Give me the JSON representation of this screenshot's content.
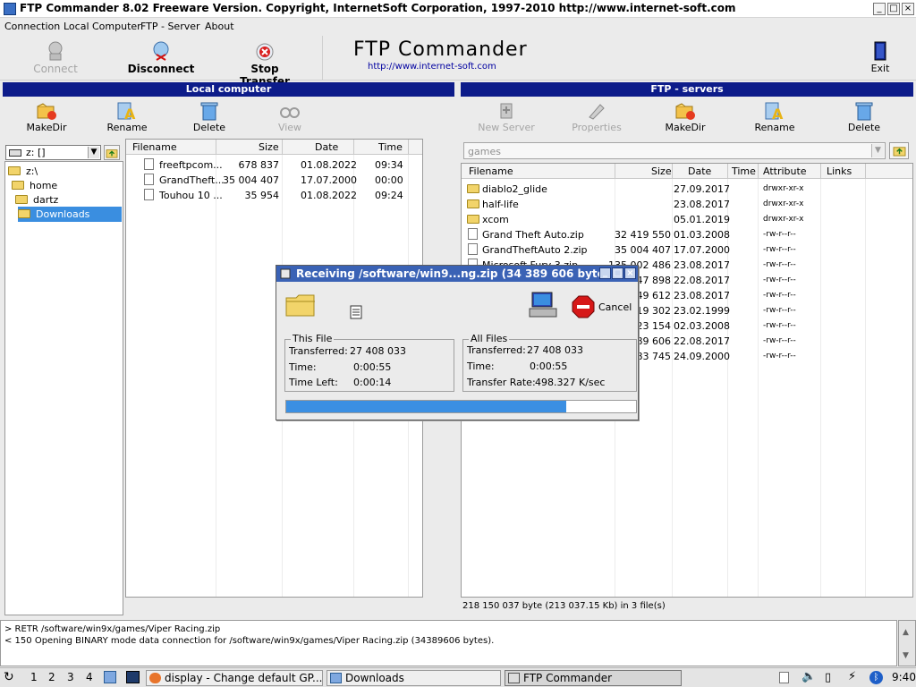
{
  "window": {
    "title": "FTP Commander 8.02  Freeware Version.  Copyright,  InternetSoft Corporation, 1997-2010   http://www.internet-soft.com"
  },
  "menu": [
    "Connection",
    "Local Computer",
    "FTP - Server",
    "About"
  ],
  "toolbar": {
    "connect": "Connect",
    "disconnect": "Disconnect",
    "stop_transfer": "Stop Transfer",
    "brand": "FTP Commander",
    "brand_url": "http://www.internet-soft.com",
    "exit": "Exit"
  },
  "local": {
    "header": "Local computer",
    "buttons": {
      "makedir": "MakeDir",
      "rename": "Rename",
      "delete": "Delete",
      "view": "View"
    },
    "drive": "z: []",
    "tree": [
      "z:\\",
      "home",
      "dartz",
      "Downloads"
    ],
    "columns": [
      "Filename",
      "Size",
      "Date",
      "Time"
    ],
    "files": [
      {
        "name": "freeftpcom...",
        "size": "678 837",
        "date": "01.08.2022",
        "time": "09:34"
      },
      {
        "name": "GrandTheft...",
        "size": "35 004 407",
        "date": "17.07.2000",
        "time": "00:00"
      },
      {
        "name": "Touhou 10 ...",
        "size": "35 954",
        "date": "01.08.2022",
        "time": "09:24"
      }
    ]
  },
  "remote": {
    "header": "FTP - servers",
    "buttons": {
      "new_server": "New Server",
      "properties": "Properties",
      "makedir": "MakeDir",
      "rename": "Rename",
      "delete": "Delete"
    },
    "path": "games",
    "columns": [
      "Filename",
      "Size",
      "Date",
      "Time",
      "Attribute",
      "Links"
    ],
    "files": [
      {
        "type": "folder",
        "name": "diablo2_glide",
        "size": "",
        "date": "27.09.2017",
        "attr": "drwxr-xr-x"
      },
      {
        "type": "folder",
        "name": "half-life",
        "size": "",
        "date": "23.08.2017",
        "attr": "drwxr-xr-x"
      },
      {
        "type": "folder",
        "name": "xcom",
        "size": "",
        "date": "05.01.2019",
        "attr": "drwxr-xr-x"
      },
      {
        "type": "file",
        "name": "Grand Theft Auto.zip",
        "size": "32 419 550",
        "date": "01.03.2008",
        "attr": "-rw-r--r--"
      },
      {
        "type": "file",
        "name": "GrandTheftAuto 2.zip",
        "size": "35 004 407",
        "date": "17.07.2000",
        "attr": "-rw-r--r--"
      },
      {
        "type": "file",
        "name": "Microsoft Fury 3.zip",
        "size": "135 002 486",
        "date": "23.08.2017",
        "attr": "-rw-r--r--"
      },
      {
        "type": "file",
        "name": "",
        "size": "47 898",
        "date": "22.08.2017",
        "attr": "-rw-r--r--"
      },
      {
        "type": "file",
        "name": "",
        "size": "49 612",
        "date": "23.08.2017",
        "attr": "-rw-r--r--"
      },
      {
        "type": "file",
        "name": "",
        "size": "19 302",
        "date": "23.02.1999",
        "attr": "-rw-r--r--"
      },
      {
        "type": "file",
        "name": "",
        "size": "23 154",
        "date": "02.03.2008",
        "attr": "-rw-r--r--"
      },
      {
        "type": "file",
        "name": "",
        "size": "89 606",
        "date": "22.08.2017",
        "attr": "-rw-r--r--"
      },
      {
        "type": "file",
        "name": "",
        "size": "83 745",
        "date": "24.09.2000",
        "attr": "-rw-r--r--"
      }
    ],
    "status": "218 150 037 byte (213 037.15 Kb) in 3 file(s)"
  },
  "dialog": {
    "title": "Receiving /software/win9...ng.zip (34 389 606 bytes)",
    "cancel": "Cancel",
    "this_file": {
      "label": "This File",
      "transferred_label": "Transferred:",
      "transferred": "27 408 033",
      "time_label": "Time:",
      "time": "0:00:55",
      "time_left_label": "Time Left:",
      "time_left": "0:00:14"
    },
    "all_files": {
      "label": "All Files",
      "transferred_label": "Transferred:",
      "transferred": "27 408 033",
      "time_label": "Time:",
      "time": "0:00:55",
      "rate_label": "Transfer Rate:",
      "rate": "498.327 K/sec"
    },
    "progress_fraction": 0.8
  },
  "log": [
    "> RETR /software/win9x/games/Viper Racing.zip",
    "< 150 Opening BINARY mode data connection for /software/win9x/games/Viper Racing.zip (34389606 bytes)."
  ],
  "taskbar": {
    "workspaces": [
      "1",
      "2",
      "3",
      "4"
    ],
    "tasks": [
      "display - Change default GP...",
      "Downloads",
      "FTP Commander"
    ],
    "clock": "9:40"
  }
}
